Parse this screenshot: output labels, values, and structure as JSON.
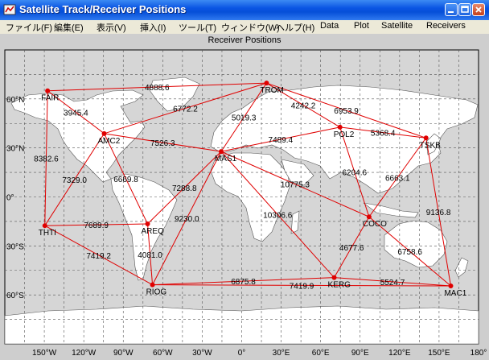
{
  "window": {
    "title": "Satellite Track/Receiver Positions",
    "controls": [
      "minimize-button",
      "maximize-button",
      "close-button"
    ]
  },
  "menu": [
    {
      "label": "ファイル(F)"
    },
    {
      "label": "編集(E)"
    },
    {
      "label": "表示(V)"
    },
    {
      "label": "挿入(I)"
    },
    {
      "label": "ツール(T)"
    },
    {
      "label": "ウィンドウ(W)"
    },
    {
      "label": "ヘルプ(H)"
    },
    {
      "label": "Data"
    },
    {
      "label": "Plot"
    },
    {
      "label": "Satellite"
    },
    {
      "label": "Receivers"
    }
  ],
  "figure": {
    "title": "Receiver Positions",
    "x_ticks": [
      "150°W",
      "120°W",
      "90°W",
      "60°W",
      "30°W",
      "0°",
      "30°E",
      "60°E",
      "90°E",
      "120°E",
      "150°E",
      "180°"
    ],
    "y_ticks": [
      "60°N",
      "30°N",
      "0°",
      "30°S",
      "60°S"
    ],
    "colors": {
      "link": "#e00000",
      "land": "#ffffff",
      "ocean": "#d6d6d6",
      "grid": "#555555"
    }
  },
  "chart_data": {
    "type": "scatter",
    "title": "Receiver Positions",
    "xlim": [
      -180,
      180
    ],
    "ylim": [
      -90,
      90
    ],
    "grid": true,
    "stations": [
      {
        "name": "FAIR",
        "lon": -147.5,
        "lat": 64.98
      },
      {
        "name": "AMC2",
        "lon": -104.5,
        "lat": 38.8
      },
      {
        "name": "THTI",
        "lon": -149.6,
        "lat": -17.6
      },
      {
        "name": "AREQ",
        "lon": -71.5,
        "lat": -16.5
      },
      {
        "name": "RIOG",
        "lon": -67.8,
        "lat": -53.8
      },
      {
        "name": "MAS1",
        "lon": -15.6,
        "lat": 27.8
      },
      {
        "name": "TROM",
        "lon": 18.9,
        "lat": 69.7
      },
      {
        "name": "POL2",
        "lon": 74.7,
        "lat": 42.7
      },
      {
        "name": "TSKB",
        "lon": 140.1,
        "lat": 36.1
      },
      {
        "name": "COCO",
        "lon": 96.8,
        "lat": -12.2
      },
      {
        "name": "KERG",
        "lon": 70.3,
        "lat": -49.4
      },
      {
        "name": "MAC1",
        "lon": 158.9,
        "lat": -54.5
      }
    ],
    "links": [
      {
        "from": "FAIR",
        "to": "TROM",
        "label": "4888.6"
      },
      {
        "from": "FAIR",
        "to": "AMC2",
        "label": "3945.4"
      },
      {
        "from": "FAIR",
        "to": "THTI",
        "label": "8382.6"
      },
      {
        "from": "AMC2",
        "to": "TROM",
        "label": "6772.2"
      },
      {
        "from": "AMC2",
        "to": "MAS1",
        "label": "7526.3"
      },
      {
        "from": "AMC2",
        "to": "THTI",
        "label": "7329.0"
      },
      {
        "from": "AMC2",
        "to": "AREQ",
        "label": "6669.8"
      },
      {
        "from": "MAS1",
        "to": "TROM",
        "label": "5019.3"
      },
      {
        "from": "MAS1",
        "to": "AREQ",
        "label": "7288.8"
      },
      {
        "from": "MAS1",
        "to": "RIOG",
        "label": "9230.0"
      },
      {
        "from": "MAS1",
        "to": "POL2",
        "label": "7489.4"
      },
      {
        "from": "MAS1",
        "to": "COCO",
        "label": "10775.3"
      },
      {
        "from": "MAS1",
        "to": "KERG",
        "label": "10306.6"
      },
      {
        "from": "TROM",
        "to": "POL2",
        "label": "4242.2"
      },
      {
        "from": "TROM",
        "to": "TSKB",
        "label": "6953.9"
      },
      {
        "from": "POL2",
        "to": "TSKB",
        "label": "5368.4"
      },
      {
        "from": "POL2",
        "to": "COCO",
        "label": "6204.6"
      },
      {
        "from": "TSKB",
        "to": "COCO",
        "label": "6663.1"
      },
      {
        "from": "TSKB",
        "to": "MAC1",
        "label": "9136.8"
      },
      {
        "from": "COCO",
        "to": "KERG",
        "label": "4677.6"
      },
      {
        "from": "COCO",
        "to": "MAC1",
        "label": "6758.6"
      },
      {
        "from": "KERG",
        "to": "MAC1",
        "label": "5524.7"
      },
      {
        "from": "KERG",
        "to": "RIOG",
        "label": "6875.8"
      },
      {
        "from": "RIOG",
        "to": "MAC1",
        "label": "7419.9"
      },
      {
        "from": "THTI",
        "to": "AREQ",
        "label": "7689.9"
      },
      {
        "from": "THTI",
        "to": "RIOG",
        "label": "7419.2"
      },
      {
        "from": "AREQ",
        "to": "RIOG",
        "label": "4081.0"
      }
    ]
  }
}
